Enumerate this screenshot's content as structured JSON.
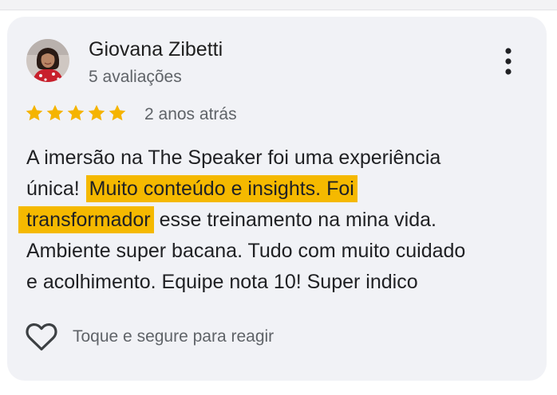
{
  "review": {
    "author_name": "Giovana Zibetti",
    "author_reviews": "5 avaliações",
    "rating": 5,
    "rating_max": 5,
    "date": "2 anos atrás",
    "text_lines": [
      {
        "before": "A imersão na The Speaker foi uma experiência",
        "highlight": "",
        "after": ""
      },
      {
        "before": "única! ",
        "highlight": "Muito conteúdo e insights. Foi",
        "after": ""
      },
      {
        "before": "",
        "highlight": "transformador",
        "after": " esse treinamento na mina vida."
      },
      {
        "before": "Ambiente super bacana. Tudo com muito cuidado",
        "highlight": "",
        "after": ""
      },
      {
        "before": "e acolhimento. Equipe nota 10! Super indico",
        "highlight": "",
        "after": ""
      }
    ],
    "react_label": "Toque e segure para reagir"
  },
  "colors": {
    "star": "#f5b400",
    "highlight": "#f5b900",
    "card_bg": "#f1f2f6",
    "text_primary": "#202124",
    "text_secondary": "#5f6368"
  },
  "icons": {
    "menu": "more-vert-icon",
    "star": "star-icon",
    "react": "heart-outline-icon",
    "avatar": "avatar"
  }
}
